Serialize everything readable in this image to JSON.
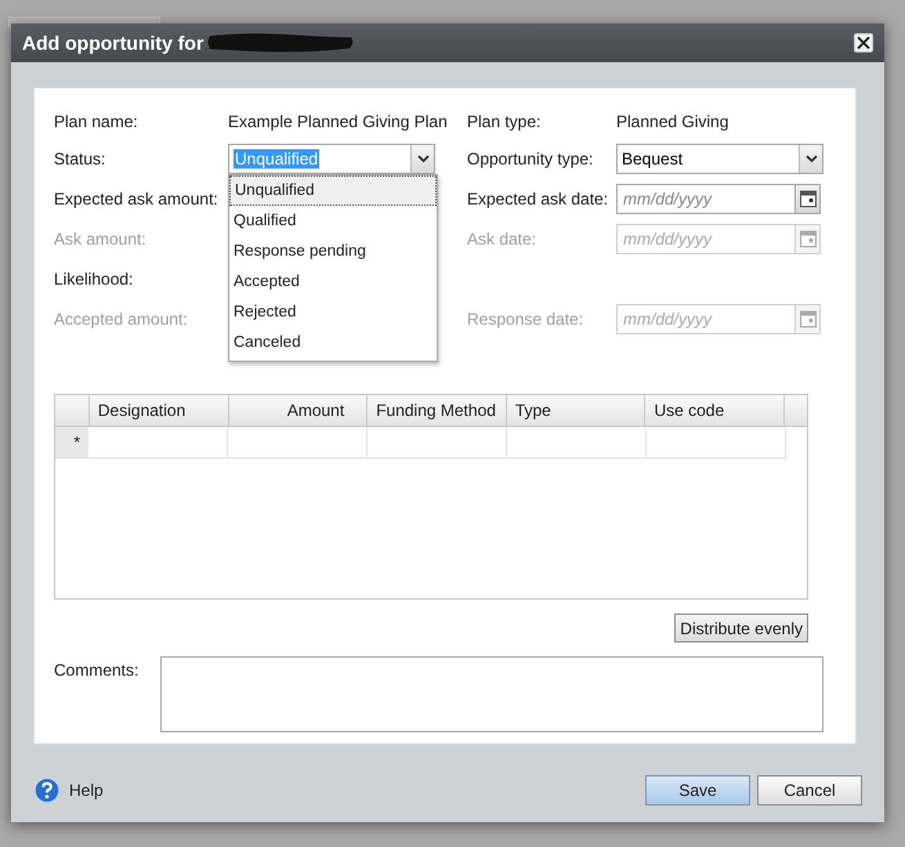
{
  "window": {
    "title": "Add opportunity for"
  },
  "rows": [
    {
      "left": {
        "label": "Plan name:",
        "disabled": false,
        "kind": "text",
        "value": "Example Planned Giving Plan"
      },
      "right": {
        "label": "Plan type:",
        "disabled": false,
        "kind": "text",
        "value": "Planned Giving"
      }
    },
    {
      "left": {
        "label": "Status:",
        "disabled": false,
        "kind": "dropdown",
        "value": "Unqualified",
        "open": true
      },
      "right": {
        "label": "Opportunity type:",
        "disabled": false,
        "kind": "dropdown",
        "value": "Bequest",
        "open": false
      }
    },
    {
      "left": {
        "label": "Expected ask amount:",
        "disabled": false,
        "kind": "hidden"
      },
      "right": {
        "label": "Expected ask date:",
        "disabled": false,
        "kind": "date",
        "placeholder": "mm/dd/yyyy"
      }
    },
    {
      "left": {
        "label": "Ask amount:",
        "disabled": true,
        "kind": "hidden"
      },
      "right": {
        "label": "Ask date:",
        "disabled": true,
        "kind": "date",
        "placeholder": "mm/dd/yyyy"
      }
    },
    {
      "left": {
        "label": "Likelihood:",
        "disabled": false,
        "kind": "hidden"
      }
    },
    {
      "left": {
        "label": "Accepted amount:",
        "disabled": true,
        "kind": "hidden"
      },
      "right": {
        "label": "Response date:",
        "disabled": true,
        "kind": "date",
        "placeholder": "mm/dd/yyyy"
      }
    }
  ],
  "status_options": [
    {
      "label": "Unqualified",
      "selected": true
    },
    {
      "label": "Qualified",
      "selected": false
    },
    {
      "label": "Response pending",
      "selected": false
    },
    {
      "label": "Accepted",
      "selected": false
    },
    {
      "label": "Rejected",
      "selected": false
    },
    {
      "label": "Canceled",
      "selected": false
    }
  ],
  "grid": {
    "columns": [
      {
        "label": "Designation",
        "kind": "text"
      },
      {
        "label": "Amount",
        "kind": "amount"
      },
      {
        "label": "Funding Method",
        "kind": "text"
      },
      {
        "label": "Type",
        "kind": "text"
      },
      {
        "label": "Use code",
        "kind": "text"
      }
    ],
    "new_row_marker": "*"
  },
  "distribute_button": "Distribute evenly",
  "comments": {
    "label": "Comments:"
  },
  "footer": {
    "help": "Help",
    "buttons": [
      {
        "label": "Save",
        "default": true
      },
      {
        "label": "Cancel",
        "default": false
      }
    ]
  }
}
